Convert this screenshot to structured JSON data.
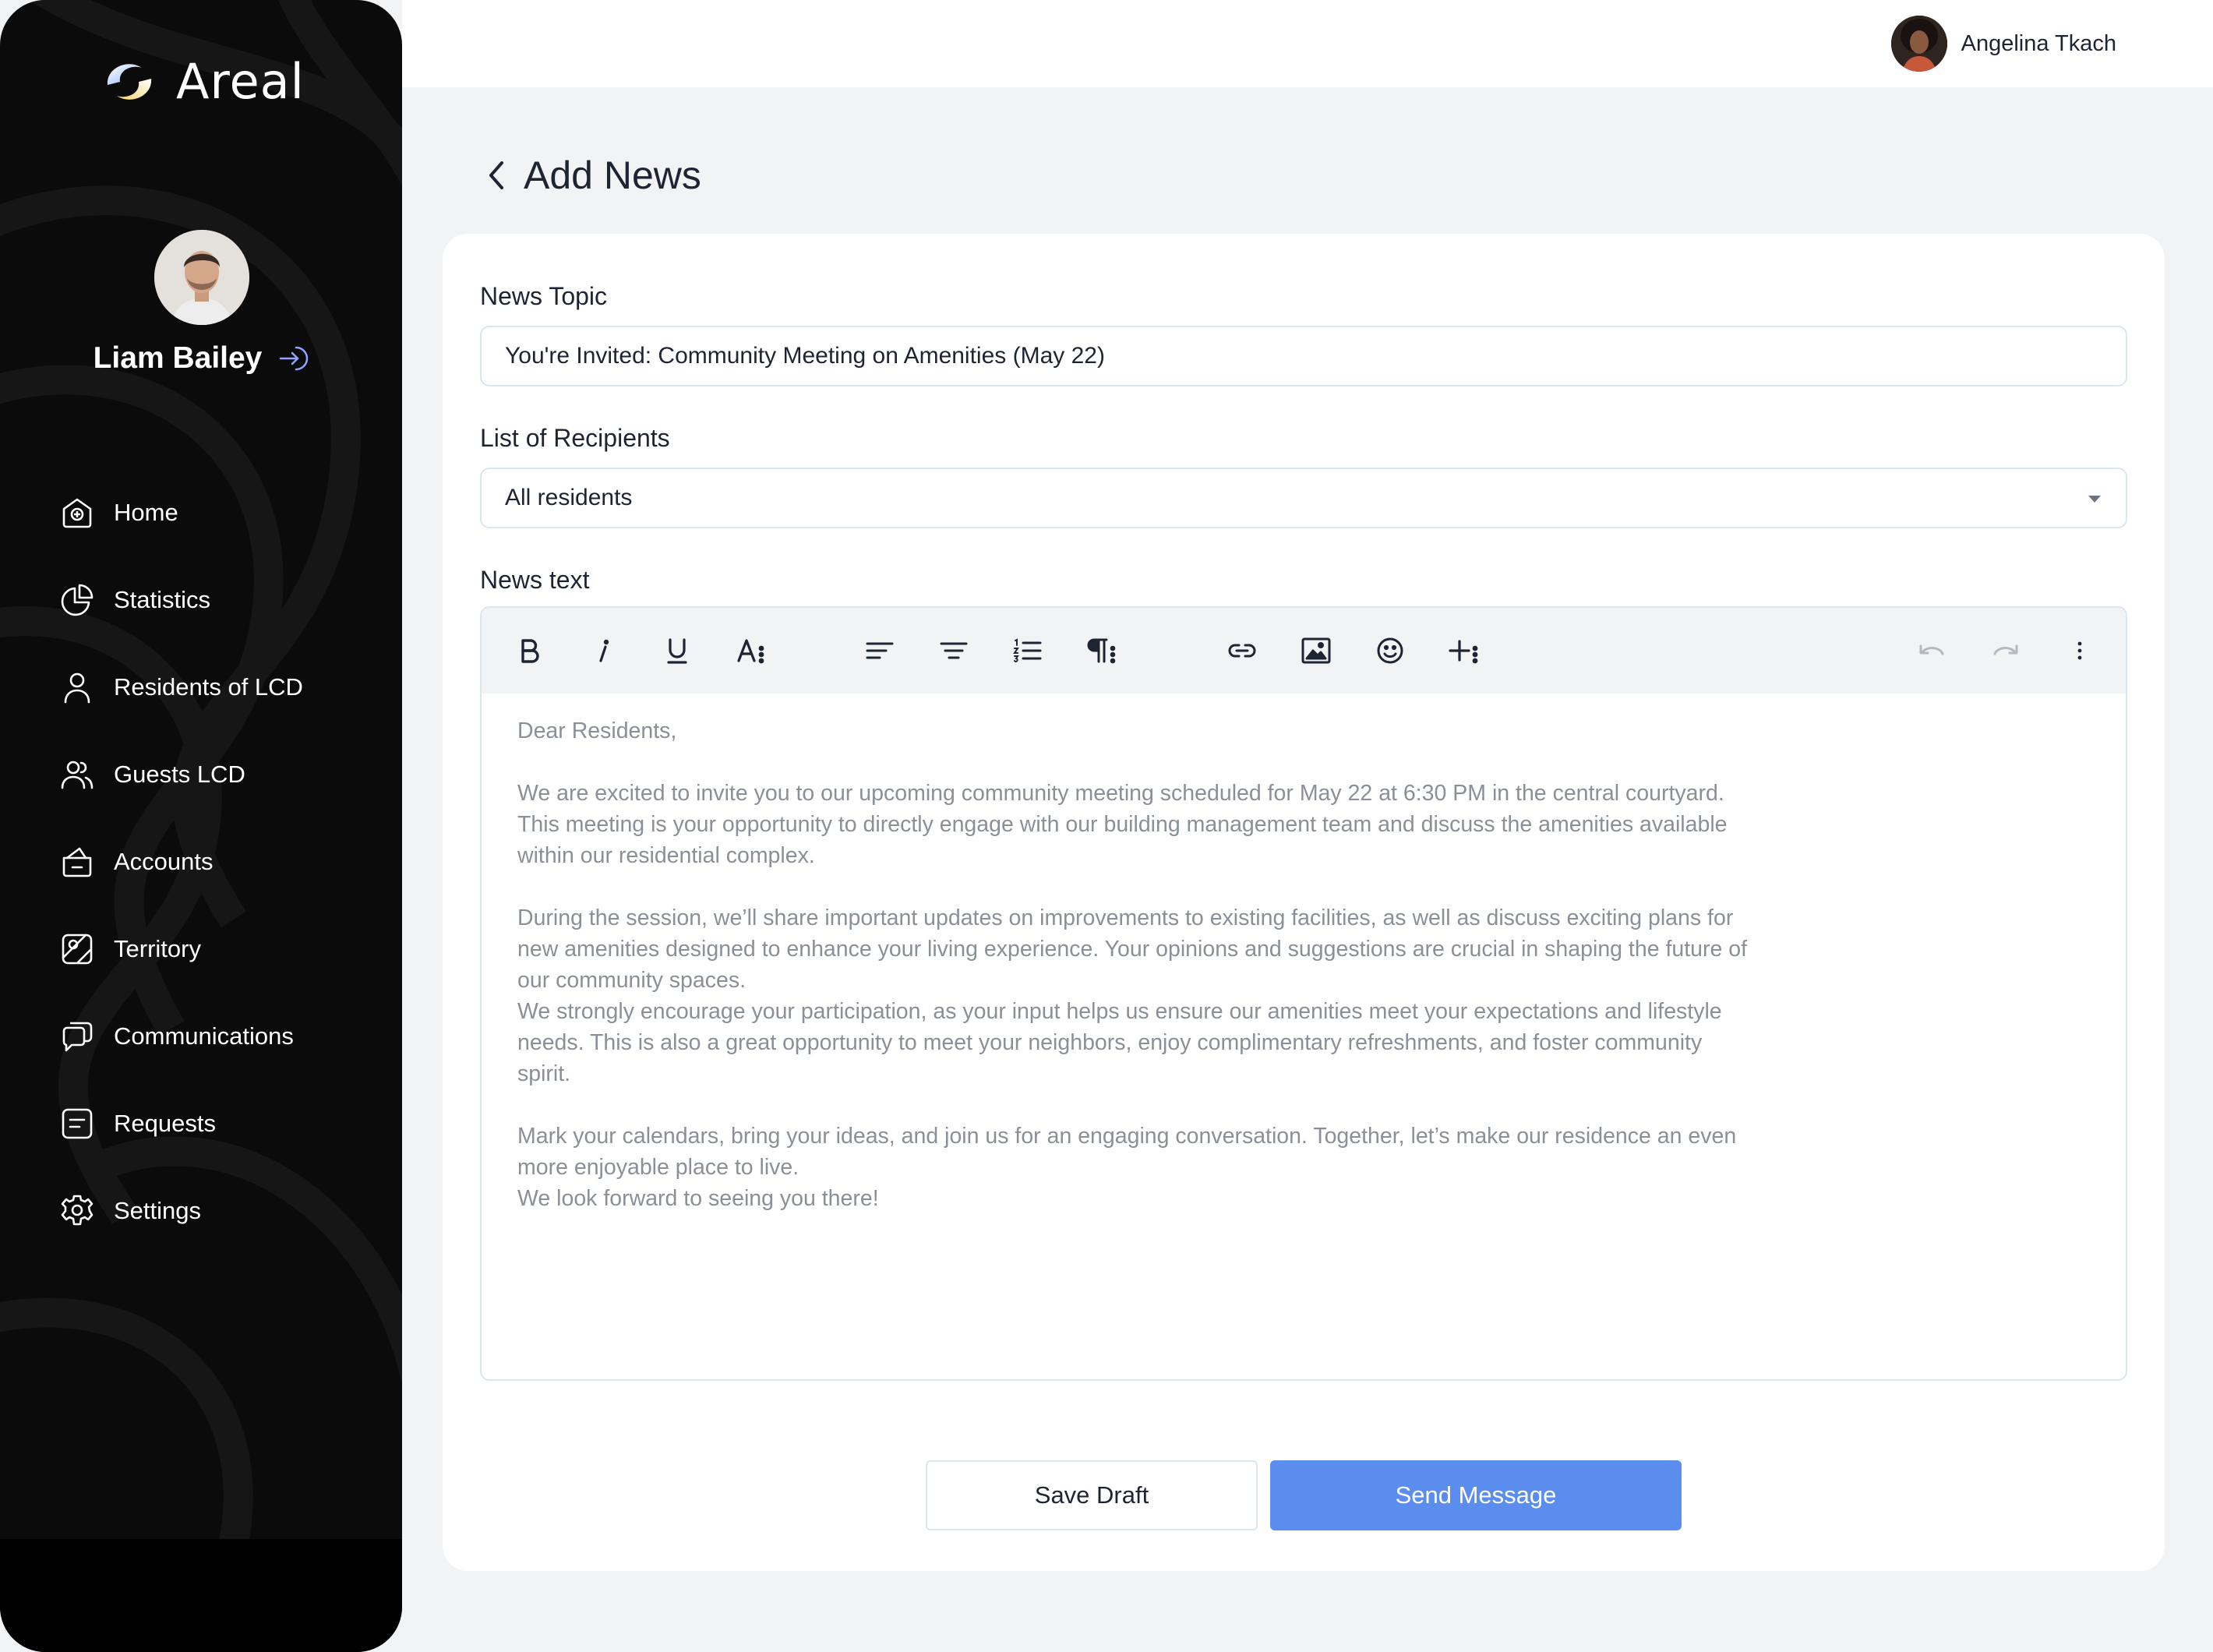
{
  "brand": {
    "name": "Areal",
    "logo_icon": "areal-logo-icon"
  },
  "profile": {
    "name": "Liam Bailey",
    "logout_icon": "logout-arrow-icon"
  },
  "nav": [
    {
      "label": "Home",
      "icon": "home-icon"
    },
    {
      "label": "Statistics",
      "icon": "pie-chart-icon"
    },
    {
      "label": "Residents of LCD",
      "icon": "user-icon"
    },
    {
      "label": "Guests LCD",
      "icon": "users-icon"
    },
    {
      "label": "Accounts",
      "icon": "wallet-icon"
    },
    {
      "label": "Territory",
      "icon": "map-icon"
    },
    {
      "label": "Communications",
      "icon": "chat-icon"
    },
    {
      "label": "Requests",
      "icon": "document-icon"
    },
    {
      "label": "Settings",
      "icon": "gear-icon"
    }
  ],
  "topbar": {
    "user_name": "Angelina Tkach"
  },
  "page": {
    "title": "Add News"
  },
  "form": {
    "topic_label": "News Topic",
    "topic_value": "You're Invited: Community Meeting on Amenities (May 22)",
    "recipients_label": "List of Recipients",
    "recipients_value": "All residents",
    "text_label": "News text"
  },
  "toolbar": {
    "items": [
      "bold-icon",
      "italic-icon",
      "underline-icon",
      "font-size-icon",
      "align-left-icon",
      "align-center-icon",
      "numbered-list-icon",
      "paragraph-icon",
      "link-icon",
      "image-icon",
      "emoji-icon",
      "insert-icon",
      "undo-icon",
      "redo-icon",
      "more-vertical-icon"
    ]
  },
  "editor": {
    "lines": [
      "Dear Residents,",
      "",
      "We are excited to invite you to our upcoming community meeting scheduled for May 22 at 6:30 PM in the central courtyard.",
      "This meeting is your opportunity to directly engage with our building management team and discuss the amenities available",
      "within our residential complex.",
      "",
      "During the session, we’ll share important updates on improvements to existing facilities, as well as discuss exciting plans for",
      "new amenities designed to enhance your living experience. Your opinions and suggestions are crucial in shaping the future of",
      "our community spaces.",
      "We strongly encourage your participation, as your input helps us ensure our amenities meet your expectations and lifestyle",
      "needs. This is also a great opportunity to meet your neighbors, enjoy complimentary refreshments, and foster community",
      "spirit.",
      "",
      "Mark your calendars, bring your ideas, and join us for an engaging conversation. Together, let’s make our residence an even",
      "more enjoyable place to live.",
      "We look forward to seeing you there!"
    ]
  },
  "actions": {
    "save_draft": "Save Draft",
    "send": "Send Message"
  },
  "colors": {
    "sidebar": "#0B0B0B",
    "accent": "#5B8DEF",
    "background": "#F2F3F5",
    "body_text": "#8A8F98"
  }
}
